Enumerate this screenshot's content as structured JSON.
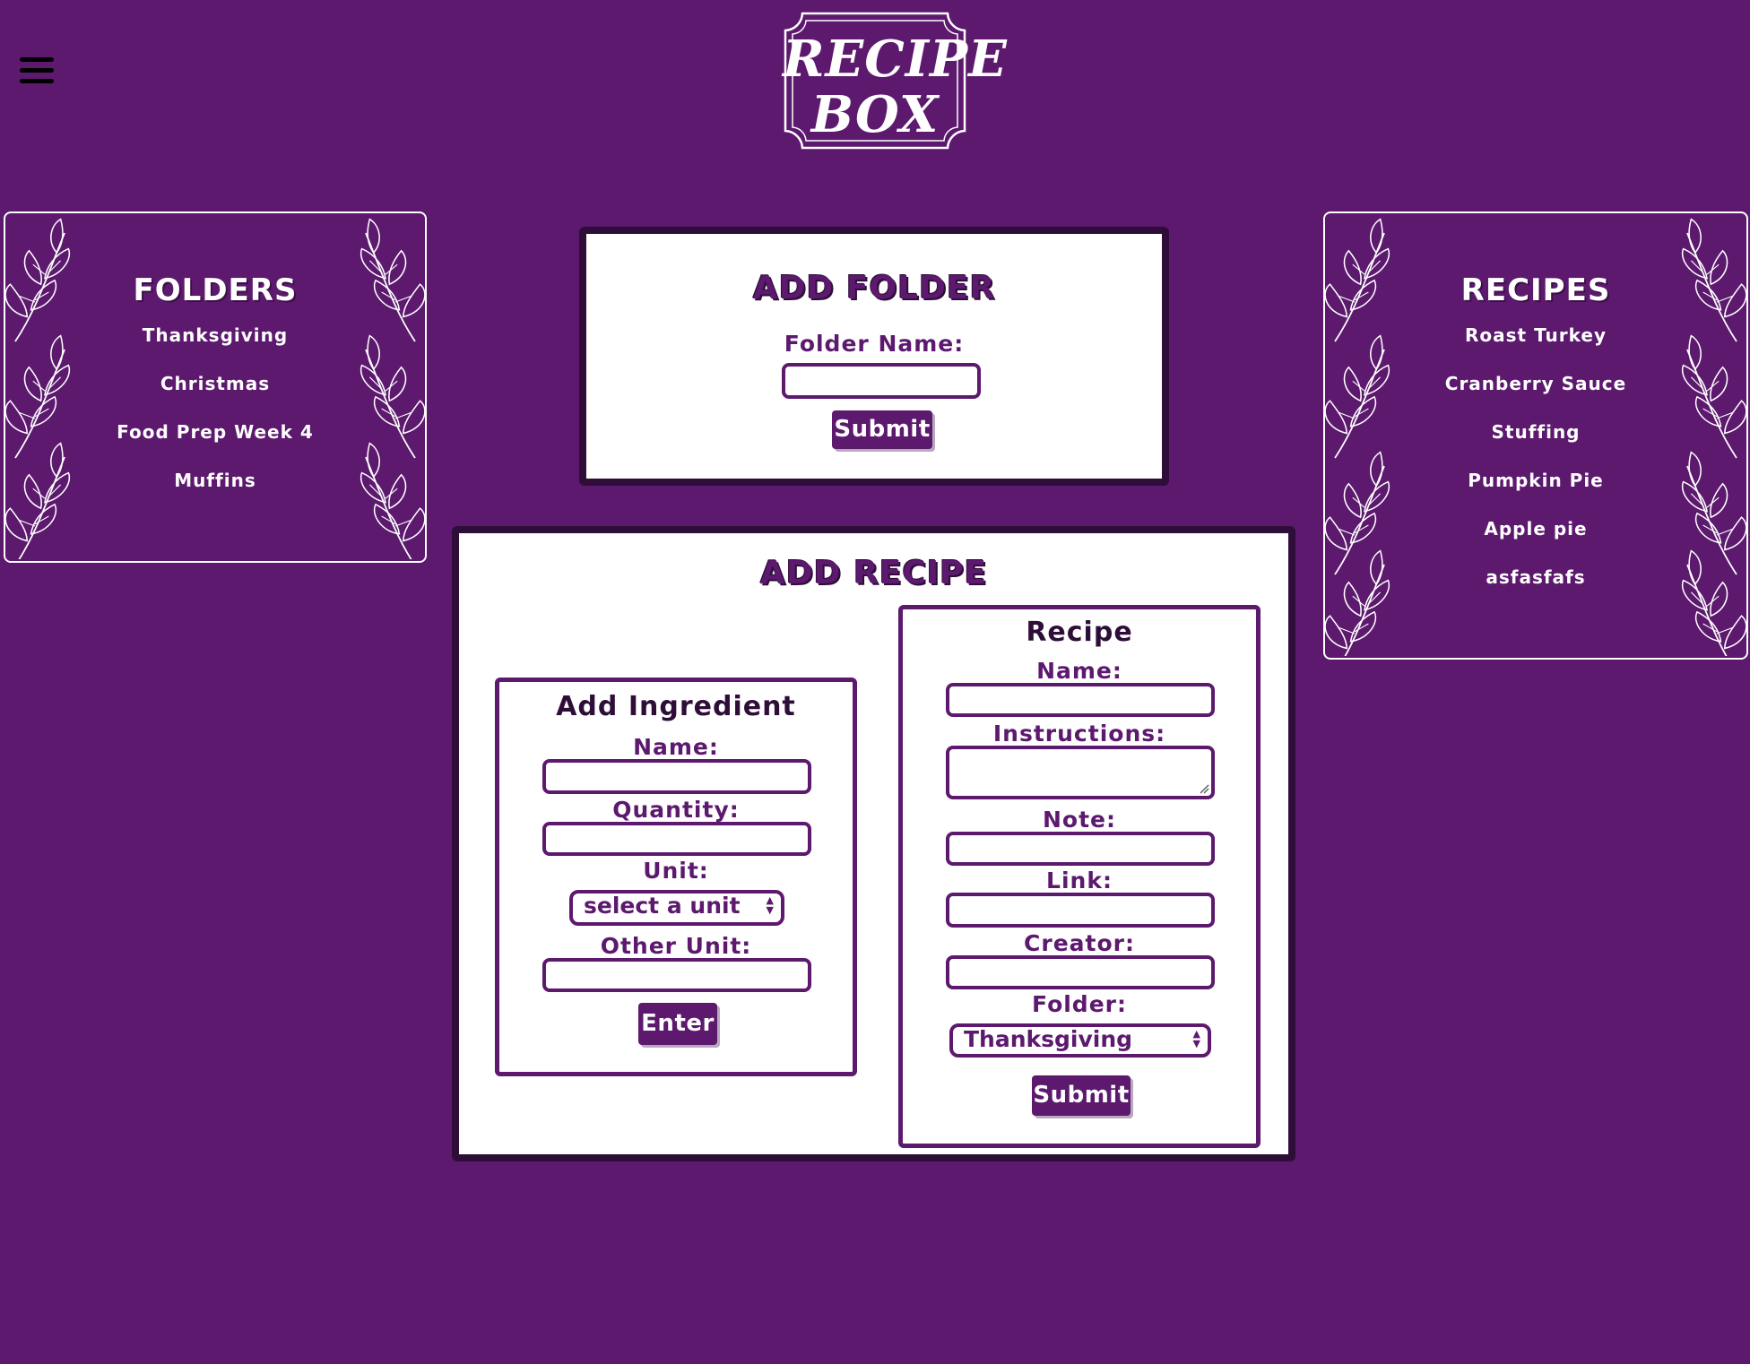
{
  "header": {
    "logo_line1": "RECIPE",
    "logo_line2": "BOX",
    "menu_icon": "hamburger-menu-icon"
  },
  "folders_panel": {
    "title": "FOLDERS",
    "items": [
      "Thanksgiving",
      "Christmas",
      "Food Prep Week 4",
      "Muffins"
    ]
  },
  "recipes_panel": {
    "title": "RECIPES",
    "items": [
      "Roast Turkey",
      "Cranberry Sauce",
      "Stuffing",
      "Pumpkin Pie",
      "Apple pie",
      "asfasfafs"
    ]
  },
  "add_folder": {
    "title": "ADD FOLDER",
    "folder_name_label": "Folder Name:",
    "folder_name_value": "",
    "submit_label": "Submit"
  },
  "add_recipe": {
    "title": "ADD RECIPE",
    "ingredient": {
      "title": "Add Ingredient",
      "name_label": "Name:",
      "quantity_label": "Quantity:",
      "unit_label": "Unit:",
      "unit_selected": "select a unit",
      "other_unit_label": "Other Unit:",
      "enter_label": "Enter"
    },
    "recipe": {
      "title": "Recipe",
      "name_label": "Name:",
      "instructions_label": "Instructions:",
      "note_label": "Note:",
      "link_label": "Link:",
      "creator_label": "Creator:",
      "folder_label": "Folder:",
      "folder_selected": "Thanksgiving",
      "submit_label": "Submit"
    }
  },
  "colors": {
    "background": "#5c196e",
    "dark_border": "#2e0e38",
    "card_background": "#ffffff"
  }
}
